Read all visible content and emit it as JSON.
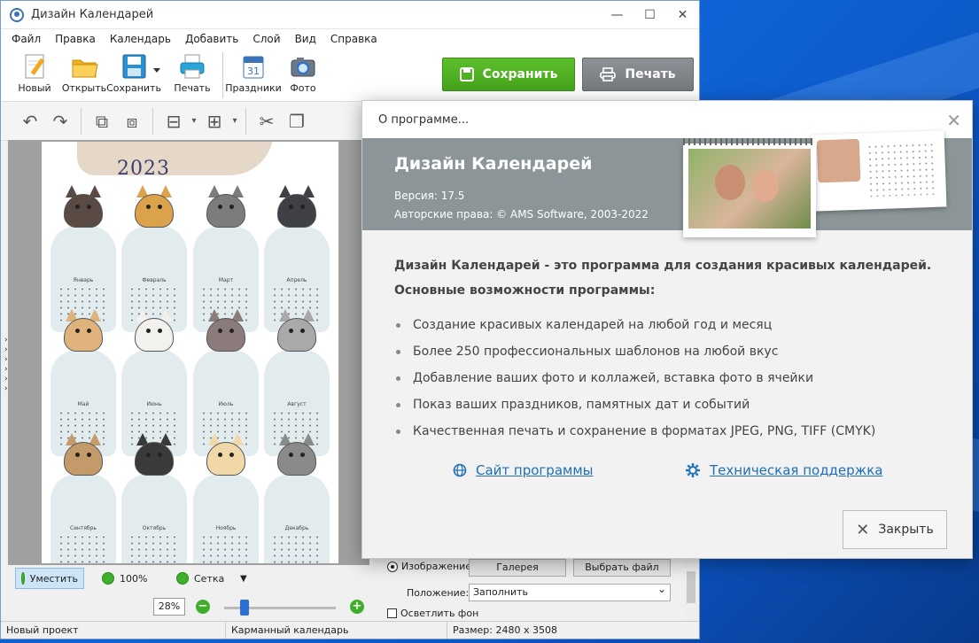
{
  "window": {
    "title": "Дизайн Календарей",
    "minimize": "—",
    "maximize": "☐",
    "close": "✕"
  },
  "menu": [
    "Файл",
    "Правка",
    "Календарь",
    "Добавить",
    "Слой",
    "Вид",
    "Справка"
  ],
  "toolbar": {
    "new": "Новый",
    "open": "Открыть",
    "save": "Сохранить",
    "print": "Печать",
    "holidays": "Праздники",
    "photo": "Фото",
    "save_big": "Сохранить",
    "print_big": "Печать"
  },
  "calendar_preview": {
    "year": "2023",
    "months": [
      "Январь",
      "Февраль",
      "Март",
      "Апрель",
      "Май",
      "Июнь",
      "Июль",
      "Август",
      "Сентябрь",
      "Октябрь",
      "Ноябрь",
      "Декабрь"
    ]
  },
  "zoom": {
    "fit": "Уместить",
    "hundred": "100%",
    "grid": "Сетка",
    "value": "28%",
    "minus": "−",
    "plus": "+",
    "level": 0.18
  },
  "properties": {
    "image_radio": "Изображение",
    "gallery_btn": "Галерея",
    "choose_file_btn": "Выбрать файл",
    "position_label": "Положение:",
    "position_value": "Заполнить",
    "lighten_bg": "Осветлить фон"
  },
  "status": {
    "project": "Новый проект",
    "template": "Карманный календарь",
    "size": "Размер: 2480 x 3508"
  },
  "about": {
    "title": "О программе...",
    "app_name": "Дизайн Календарей",
    "version": "Версия: 17.5",
    "copyright": "Авторские права: © AMS Software, 2003-2022",
    "lead": "Дизайн Календарей - это программа для создания красивых календарей.",
    "features_title": "Основные возможности программы:",
    "features": [
      "Создание красивых календарей на любой год и месяц",
      "Более 250 профессиональных шаблонов на любой вкус",
      "Добавление ваших фото и коллажей, вставка фото в ячейки",
      "Показ ваших праздников, памятных дат и событий",
      "Качественная печать и сохранение в форматах JPEG, PNG, TIFF (CMYK)"
    ],
    "site_link": "Сайт программы",
    "support_link": "Техническая поддержка",
    "close_btn": "Закрыть"
  },
  "colors": {
    "save_green": "#4cb022",
    "print_gray": "#808488",
    "banner_gray": "#8c9698",
    "link_blue": "#1f6fb5"
  }
}
